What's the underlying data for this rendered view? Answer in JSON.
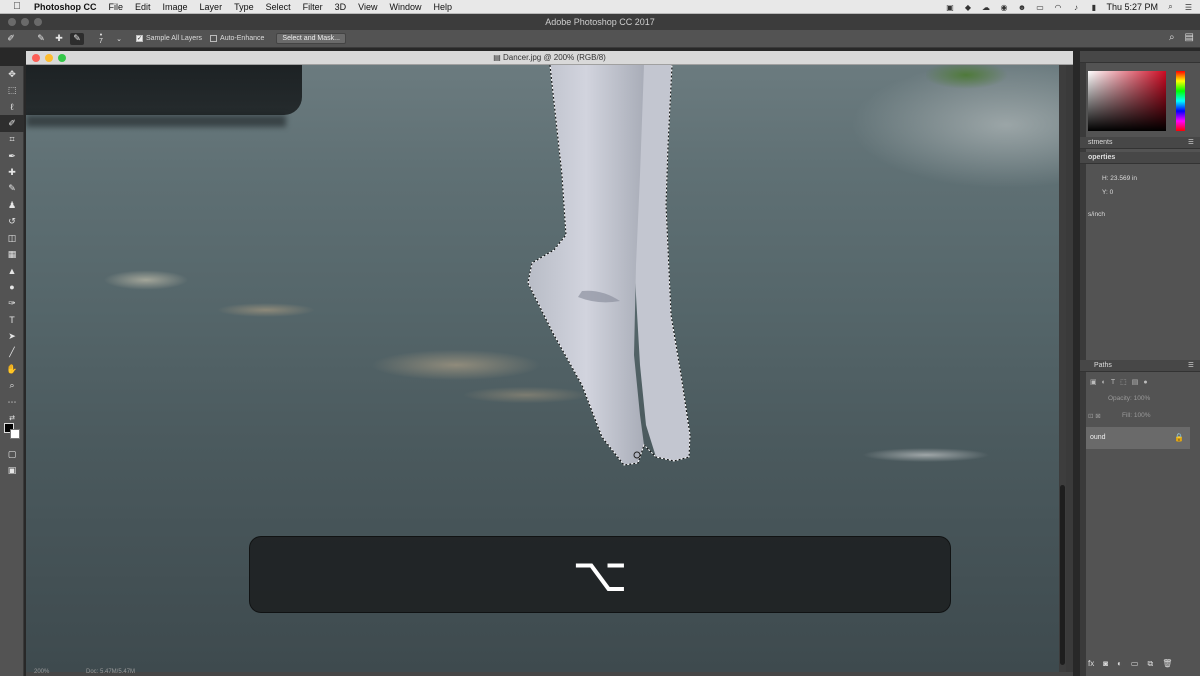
{
  "menubar": {
    "apple": "",
    "app_name": "Photoshop CC",
    "items": [
      "File",
      "Edit",
      "Image",
      "Layer",
      "Type",
      "Select",
      "Filter",
      "3D",
      "View",
      "Window",
      "Help"
    ],
    "clock": "Thu 5:27 PM"
  },
  "app_title": "Adobe Photoshop CC 2017",
  "options": {
    "brush_size": "7",
    "sample_all_layers": "Sample All Layers",
    "auto_enhance": "Auto-Enhance",
    "select_and_mask": "Select and Mask..."
  },
  "document": {
    "title": "Dancer.jpg @ 200% (RGB/8)",
    "zoom_status": "200%",
    "doc_status": "Doc: 5.47M/5.47M"
  },
  "hud_key": "⌥",
  "panels": {
    "adjustments_tab": "stments",
    "properties_tab": "operties",
    "height_value": "H: 23.569 in",
    "y_value": "Y: 0",
    "resolution_unit": "s/inch",
    "paths_tab": "Paths",
    "opacity_label": "Opacity: 100%",
    "fill_label": "Fill: 100%",
    "layer_name": "ound"
  },
  "colors": {
    "accent_red": "#cc0a22",
    "panel_bg": "#535353"
  }
}
